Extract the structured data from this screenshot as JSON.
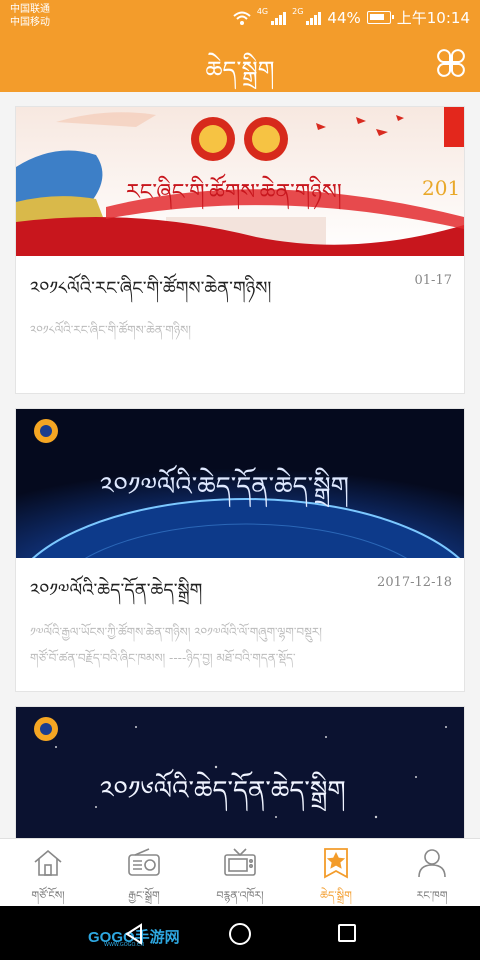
{
  "status": {
    "carrier1": "中国联通",
    "carrier2": "中国移动",
    "net1": "4G",
    "net2": "2G",
    "battery": "44%",
    "time": "上午10:14"
  },
  "header": {
    "title": "ཆེད་སྒྲིག",
    "menu_icon": "four-leaf-menu-icon"
  },
  "cards": [
    {
      "banner_text": "རང་ཞིང་གི་ཚོགས་ཆེན་གཉིས།",
      "banner_year": "201",
      "title": "༢༠༡༨ལོའི་རང་ཞིང་གི་ཚོགས་ཆེན་གཉིས།",
      "date": "01-17",
      "summary": "༢༠༡༨ལོའི་རང་ཞིང་གི་ཚོགས་ཆེན་གཉིས།"
    },
    {
      "banner_text": "༢༠༡༧ལོའི་ཆེད་དོན་ཆེད་སྒྲིག",
      "title": "༢༠༡༧ལོའི་ཆེད་དོན་ཆེད་སྒྲིག",
      "date": "2017-12-18",
      "summary_line1": "༡༧ལོའི་རྒྱལ་ཡོངས་ཀྱི་ཚོགས་ཆེན་གཉིས། ༢༠༡༧ལོའི་ལོ་གཞུག་ལྷག་བསྡུར།",
      "summary_line2": "གཙོ་བོ་ཚན་བརྗོད་བའི་ཞིང་ཁམས། ----ཉིད་བྱ། མཐོ་བའི་གདན་སྡོད་"
    },
    {
      "banner_text": "༢༠༡༦ལོའི་ཆེད་དོན་ཆེད་སྒྲིག"
    }
  ],
  "tabs": [
    {
      "label": "གཙོ་ངོས།",
      "icon": "home-icon"
    },
    {
      "label": "རྒྱང་སྒྲོག",
      "icon": "radio-icon"
    },
    {
      "label": "བརྙན་འཁོར།",
      "icon": "tv-icon"
    },
    {
      "label": "ཆེད་སྒྲིག",
      "icon": "special-topic-icon"
    },
    {
      "label": "རང་ཁག",
      "icon": "user-icon"
    }
  ],
  "watermark": {
    "text": "GOGO手游网",
    "sub": "WWW.GOGO.CN"
  },
  "colors": {
    "accent": "#f39c2b",
    "banner_red": "#c8161d",
    "banner_night": "#0b1230"
  }
}
